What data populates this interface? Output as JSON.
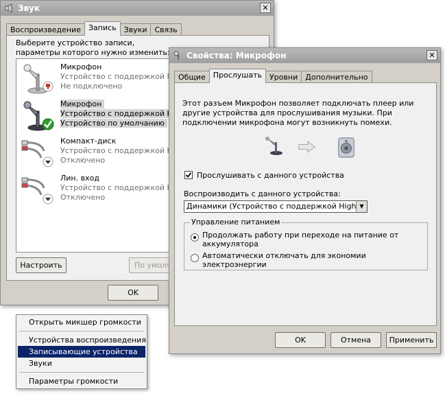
{
  "sound_window": {
    "title": "Звук",
    "close_label": "✕",
    "tabs": [
      "Воспроизведение",
      "Запись",
      "Звуки",
      "Связь"
    ],
    "active_tab": 1,
    "instruction": "Выберите устройство записи, параметры которого нужно изменить:",
    "devices": [
      {
        "name": "Микрофон",
        "desc": "Устройство с поддержкой Hi",
        "status": "Не подключено",
        "icon": "microphone-icon",
        "badge": "unplugged"
      },
      {
        "name": "Микрофон",
        "desc": "Устройство с поддержкой Hi",
        "status": "Устройство по умолчанию",
        "icon": "microphone-icon",
        "badge": "default-check"
      },
      {
        "name": "Компакт-диск",
        "desc": "Устройство с поддержкой Hi",
        "status": "Отключено",
        "icon": "rca-cable-icon",
        "badge": "disabled"
      },
      {
        "name": "Лин. вход",
        "desc": "Устройство с поддержкой Hi",
        "status": "Отключено",
        "icon": "rca-cable-icon",
        "badge": "disabled"
      }
    ],
    "configure_button": "Настроить",
    "default_button": "По умолч",
    "ok_button": "OK",
    "selected_device": 1
  },
  "props_window": {
    "title": "Свойства: Микрофон",
    "close_label": "✕",
    "tabs": [
      "Общие",
      "Прослушать",
      "Уровни",
      "Дополнительно"
    ],
    "active_tab": 1,
    "description": "Этот разъем Микрофон позволяет подключать плеер или другие устройства для прослушивания музыки. При подключении микрофона могут возникнуть помехи.",
    "listen_checkbox": {
      "label": "Прослушивать с данного устройства",
      "checked": true
    },
    "playback_label": "Воспроизводить с данного устройства:",
    "playback_select": "Динамики (Устройство с поддержкой High Def",
    "power_group": {
      "legend": "Управление питанием",
      "options": [
        {
          "label_1": "Продолжать работу при переходе на питание от",
          "label_2": "аккумулятора",
          "selected": true
        },
        {
          "label_1": "Автоматически отключать для экономии",
          "label_2": "электроэнергии",
          "selected": false
        }
      ]
    },
    "ok_button": "OK",
    "cancel_button": "Отмена",
    "apply_button": "Применить"
  },
  "context_menu": {
    "items": [
      {
        "label": "Открыть микшер громкости",
        "selected": false
      },
      {
        "label": "Устройства воспроизведения",
        "selected": false
      },
      {
        "label": "Записывающие устройства",
        "selected": true
      },
      {
        "label": "Звуки",
        "selected": false
      },
      {
        "label": "Параметры громкости",
        "selected": false
      }
    ]
  },
  "colors": {
    "menu_highlight": "#0b246a",
    "title_gray": "#9e9e9e",
    "check_green": "#2e9e2e",
    "unplugged_red": "#c0392b"
  }
}
